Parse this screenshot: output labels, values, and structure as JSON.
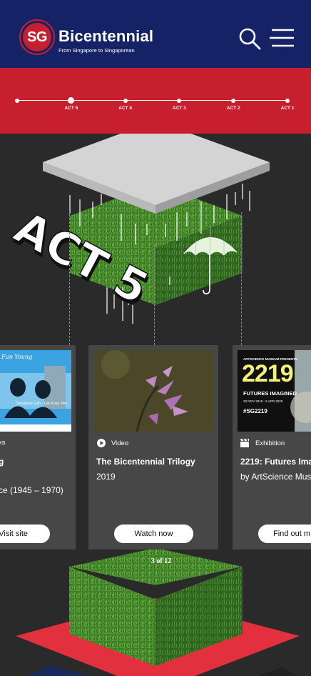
{
  "header": {
    "logo_badge": "SG",
    "logo_title": "Bicentennial",
    "logo_subtitle": "From Singapore to Singaporean",
    "search_icon": "search-icon",
    "menu_icon": "hamburger-menu-icon"
  },
  "timeline": {
    "acts": [
      {
        "label": "",
        "active": false
      },
      {
        "label": "ACT 5",
        "active": true
      },
      {
        "label": "ACT 4",
        "active": false
      },
      {
        "label": "ACT 3",
        "active": false
      },
      {
        "label": "ACT 2",
        "active": false
      },
      {
        "label": "ACT 1",
        "active": false
      }
    ]
  },
  "hero": {
    "act_heading": "ACT 5",
    "umbrella_icon": "umbrella-icon"
  },
  "cards": [
    {
      "type": "ks",
      "title": "g",
      "line2": "",
      "line3": "ce (1945 – 1970)",
      "button": "Visit site",
      "thumb_names": [
        "Constance Goh",
        "Lee Kuan Yew"
      ]
    },
    {
      "type": "Video",
      "type_icon": "play-icon",
      "title": "The Bicentennial Trilogy",
      "line2": "2019",
      "button": "Watch now"
    },
    {
      "type": "Exhibition",
      "type_icon": "clapperboard-icon",
      "title": "2219: Futures Ima",
      "line2": "by ArtScience Mus",
      "button": "Find out m",
      "thumb_text": {
        "presenter": "ARTSCIENCE MUSEUM PRESENTS",
        "year": "2219",
        "headline": "FUTURES IMAGINED",
        "dates": "23 NOV 2019 - 5 APR 2020",
        "hashtag": "#SG2219"
      }
    }
  ],
  "pager": "3 of 12",
  "colors": {
    "header_bg": "#152266",
    "timeline_bg": "#c81f2f",
    "page_bg": "#2a2a2a",
    "card_bg": "#474747",
    "grass": "#3f8a2a",
    "platform_red": "#e3303e"
  }
}
